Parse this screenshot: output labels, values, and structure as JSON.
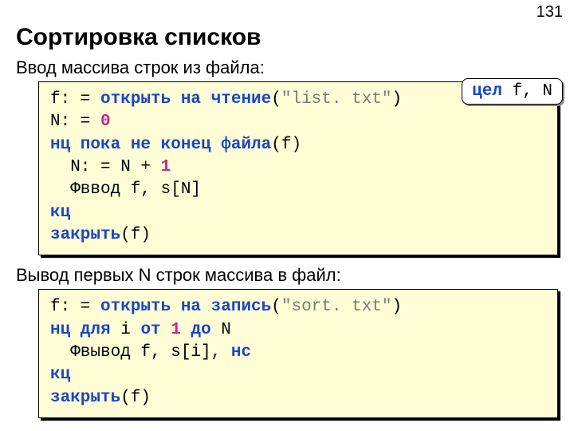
{
  "page_number": "131",
  "title": "Сортировка списков",
  "section1": {
    "heading": "Ввод массива строк из файла:",
    "callout_pre": "цел",
    "callout_post": " f, N",
    "l1a": "f: = ",
    "l1b": "открыть на чтение",
    "l1c": "(",
    "l1d": "\"list. txt\"",
    "l1e": ")",
    "l2a": "N: = ",
    "l2b": "0",
    "l3a": "нц пока не",
    "l3b": " ",
    "l3c": "конец файла",
    "l3d": "(f)",
    "l4a": "  N: = N + ",
    "l4b": "1",
    "l5a": "  Фввод f, s[N]",
    "l6a": "кц",
    "l7a": "закрыть",
    "l7b": "(f)"
  },
  "section2": {
    "heading": "Вывод первых N строк массива в файл:",
    "l1a": "f: = ",
    "l1b": "открыть на запись",
    "l1c": "(",
    "l1d": "\"sort. txt\"",
    "l1e": ")",
    "l2a": "нц для",
    "l2b": " i ",
    "l2c": "от",
    "l2d": " ",
    "l2e": "1",
    "l2f": " ",
    "l2g": "до",
    "l2h": " N",
    "l3a": "  Фвывод f, s[i], ",
    "l3b": "нс",
    "l4a": "кц",
    "l5a": "закрыть",
    "l5b": "(f)"
  }
}
